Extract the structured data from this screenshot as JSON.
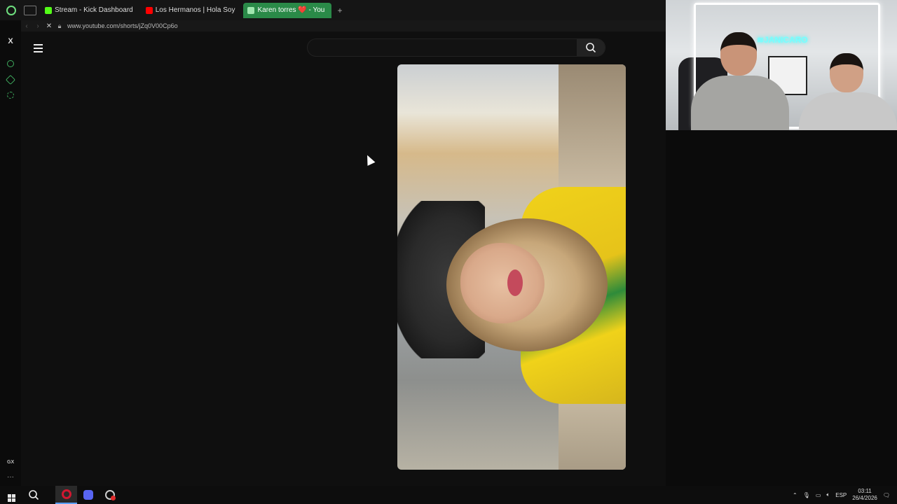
{
  "browser": {
    "tabs": [
      {
        "label": "Stream - Kick Dashboard",
        "favicon_color": "#53fc18"
      },
      {
        "label": "Los Hermanos | Hola Soy",
        "favicon_color": "#ff0000"
      },
      {
        "label": "Karen torres ❤️ - You",
        "favicon_color": "#6fe07f",
        "active": true
      }
    ],
    "new_tab_label": "+",
    "address": "www.youtube.com/shorts/jZq0V00Cp6o",
    "accent": "#2a8a48"
  },
  "sidebar": {
    "x_label": "X",
    "gx_label": "GX",
    "more_label": "···"
  },
  "webcam": {
    "sign_text": "≋JANICARO"
  },
  "taskbar": {
    "lang": "ESP",
    "time": "03:11",
    "date": "26/4/2026"
  }
}
